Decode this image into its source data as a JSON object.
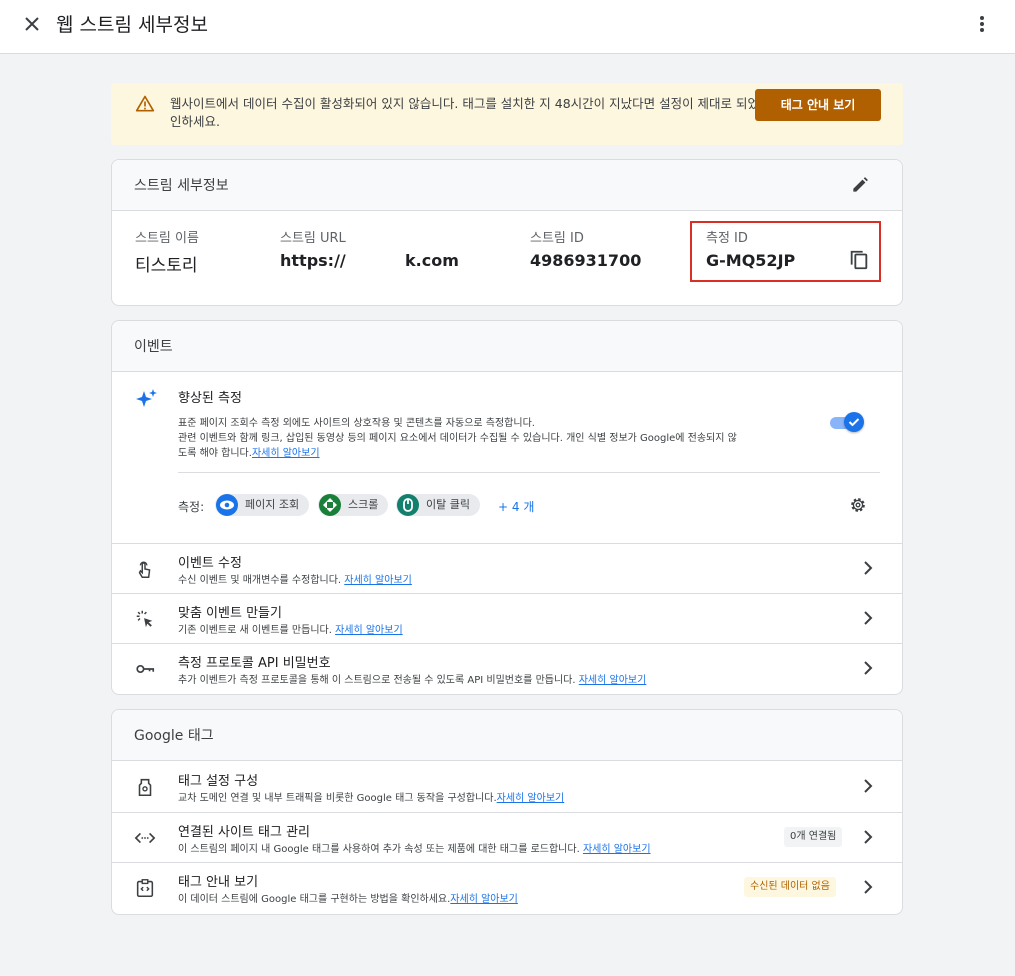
{
  "header": {
    "title": "웹 스트림 세부정보"
  },
  "banner": {
    "message": "웹사이트에서 데이터 수집이 활성화되어 있지 않습니다. 태그를 설치한 지 48시간이 지났다면 설정이 제대로 되었는지 확인하세요.",
    "button_label": "태그 안내 보기",
    "color_bg": "#fef7e0",
    "color_button": "#b06000"
  },
  "stream_details": {
    "title": "스트림 세부정보",
    "fields": [
      {
        "label": "스트림 이름",
        "value": "티스토리"
      },
      {
        "label": "스트림 URL",
        "value": "https://",
        "value_suffix": "k.com"
      },
      {
        "label": "스트림 ID",
        "value": "4986931700"
      },
      {
        "label": "측정 ID",
        "value": "G-MQ52JP"
      }
    ]
  },
  "events": {
    "title": "이벤트",
    "enhanced": {
      "title": "향상된 측정",
      "desc_line1": "표준 페이지 조회수 측정 외에도 사이트의 상호작용 및 콘텐츠를 자동으로 측정합니다.",
      "desc_line2": "관련 이벤트와 함께 링크, 삽입된 동영상 등의 페이지 요소에서 데이터가 수집될 수 있습니다. 개인 식별 정보가 Google에 전송되지 않",
      "desc_line3": "도록 해야 합니다.",
      "link": "자세히 알아보기",
      "enabled": true,
      "measure_label": "측정:",
      "chips": [
        {
          "label": "페이지 조회",
          "icon": "eye-icon",
          "color": "#1a73e8"
        },
        {
          "label": "스크롤",
          "icon": "scroll-icon",
          "color": "#188038"
        },
        {
          "label": "이탈 클릭",
          "icon": "mouse-icon",
          "color": "#12806d"
        }
      ],
      "more": "+ 4 개"
    },
    "rows": [
      {
        "title": "이벤트 수정",
        "desc": "수신 이벤트 및 매개변수를 수정합니다. ",
        "link": "자세히 알아보기",
        "icon": "touch-icon"
      },
      {
        "title": "맞춤 이벤트 만들기",
        "desc": "기존 이벤트로 새 이벤트를 만듭니다. ",
        "link": "자세히 알아보기",
        "icon": "click-sparkle-icon"
      },
      {
        "title": "측정 프로토콜 API 비밀번호",
        "desc": "추가 이벤트가 측정 프로토콜을 통해 이 스트림으로 전송될 수 있도록 API 비밀번호를 만듭니다. ",
        "link": "자세히 알아보기",
        "icon": "key-icon"
      }
    ]
  },
  "google_tag": {
    "title": "Google 태그",
    "rows": [
      {
        "title": "태그 설정 구성",
        "desc": "교차 도메인 연결 및 내부 트래픽을 비롯한 Google 태그 동작을 구성합니다.",
        "link": "자세히 알아보기",
        "icon": "tag-icon",
        "badge": ""
      },
      {
        "title": "연결된 사이트 태그 관리",
        "desc": "이 스트림의 페이지 내 Google 태그를 사용하여 추가 속성 또는 제품에 대한 태그를 로드합니다. ",
        "link": "자세히 알아보기",
        "icon": "code-icon",
        "badge": "0개 연결됨"
      },
      {
        "title": "태그 안내 보기",
        "desc": "이 데이터 스트림에 Google 태그를 구현하는 방법을 확인하세요.",
        "link": "자세히 알아보기",
        "icon": "tag-instructions-icon",
        "badge": "수신된 데이터 없음"
      }
    ]
  }
}
